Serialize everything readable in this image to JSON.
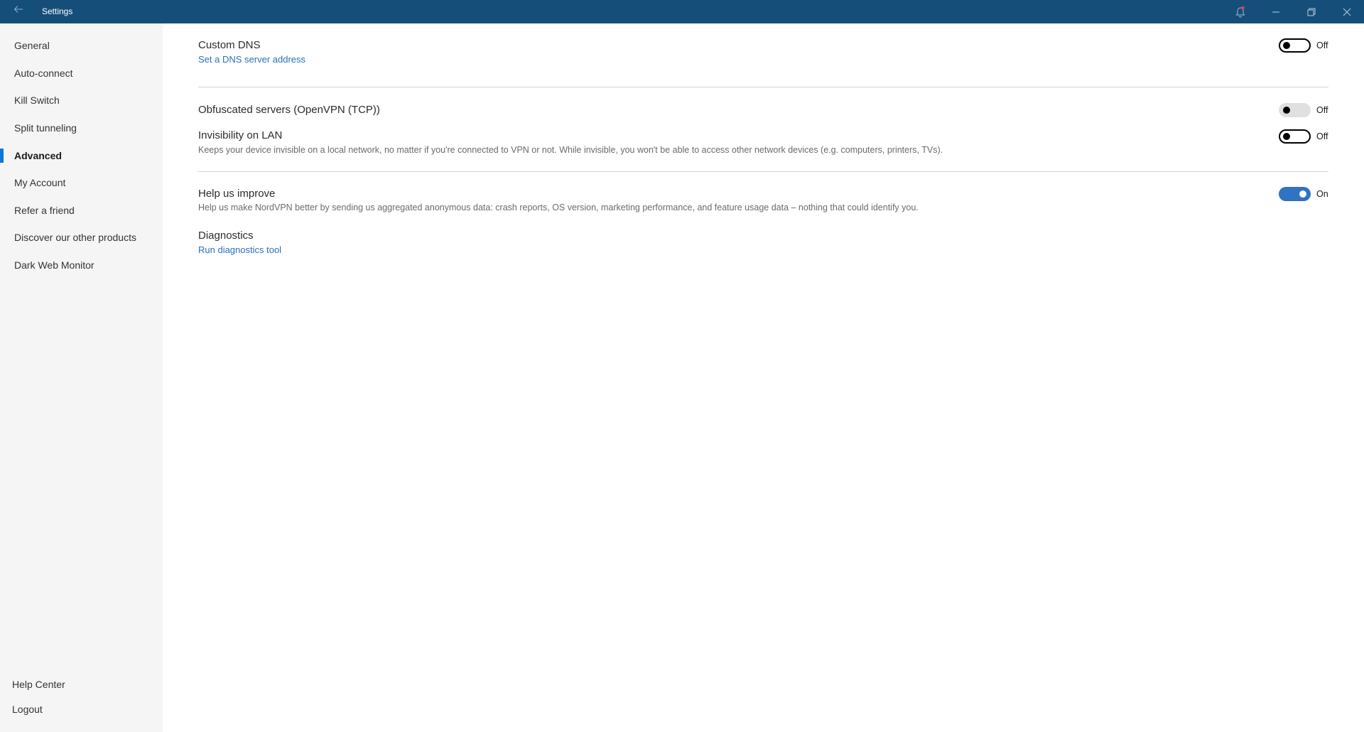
{
  "window": {
    "title": "Settings",
    "notification_badge_color": "#e8424b"
  },
  "sidebar": {
    "items": [
      {
        "label": "General"
      },
      {
        "label": "Auto-connect"
      },
      {
        "label": "Kill Switch"
      },
      {
        "label": "Split tunneling"
      },
      {
        "label": "Advanced",
        "active": true
      },
      {
        "label": "My Account"
      },
      {
        "label": "Refer a friend"
      },
      {
        "label": "Discover our other products"
      },
      {
        "label": "Dark Web Monitor"
      }
    ],
    "bottom": [
      {
        "label": "Help Center"
      },
      {
        "label": "Logout"
      }
    ]
  },
  "settings": {
    "custom_dns": {
      "title": "Custom DNS",
      "link": "Set a DNS server address",
      "state": "Off"
    },
    "obfuscated": {
      "title": "Obfuscated servers (OpenVPN (TCP))",
      "state": "Off"
    },
    "invisibility": {
      "title": "Invisibility on LAN",
      "description": "Keeps your device invisible on a local network, no matter if you're connected to VPN or not. While invisible, you won't be able to access other network devices (e.g. computers, printers, TVs).",
      "state": "Off"
    },
    "help_improve": {
      "title": "Help us improve",
      "description": "Help us make NordVPN better by sending us aggregated anonymous data: crash reports, OS version, marketing performance, and feature usage data – nothing that could identify you.",
      "state": "On"
    },
    "diagnostics": {
      "title": "Diagnostics",
      "link": "Run diagnostics tool"
    }
  },
  "colors": {
    "titlebar": "#164e7a",
    "accent": "#0a78d7",
    "link": "#2a6fba",
    "toggle_on": "#2f73c1"
  }
}
